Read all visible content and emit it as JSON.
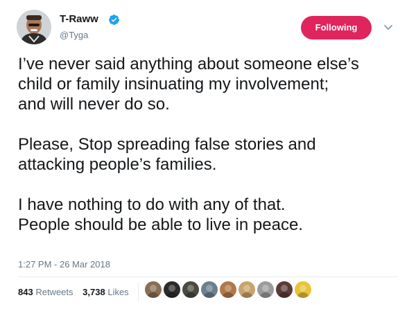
{
  "author": {
    "display_name": "T-Raww",
    "handle": "@Tyga",
    "verified_icon": "verified-badge-icon"
  },
  "follow_button": {
    "label": "Following",
    "color": "#e0245e"
  },
  "more_menu_icon": "chevron-down-icon",
  "tweet": {
    "paragraphs": [
      [
        "I’ve never said anything about someone else’s",
        "child or family insinuating my involvement;",
        "and will never do so."
      ],
      [
        "Please, Stop spreading false stories and",
        "attacking people’s families."
      ],
      [
        "I have nothing to do with any of that.",
        "People should be able to live in peace."
      ]
    ],
    "timestamp": "1:27 PM - 26 Mar 2018"
  },
  "stats": {
    "retweets_count": "843",
    "retweets_label": "Retweets",
    "likes_count": "3,738",
    "likes_label": "Likes"
  },
  "likers": {
    "count_shown": 9,
    "colors": [
      "#8a6d55",
      "#2b2b2b",
      "#4a4a40",
      "#6d7f8c",
      "#b0784a",
      "#c9a36b",
      "#9c9c9c",
      "#5b3b36",
      "#e8c23a"
    ]
  },
  "colors": {
    "text": "#14171a",
    "secondary": "#657786",
    "verified": "#1da1f2",
    "divider": "#e6ecf0"
  }
}
